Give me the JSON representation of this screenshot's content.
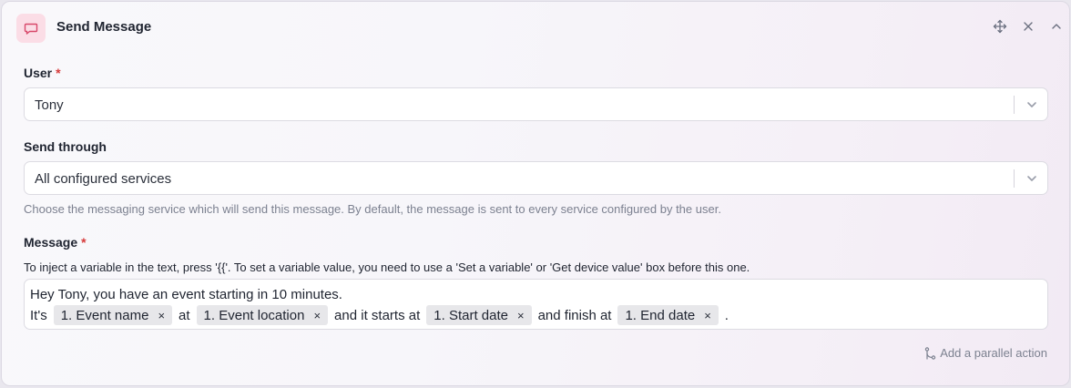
{
  "header": {
    "title": "Send Message",
    "icon": "message-icon",
    "actions": [
      "move-icon",
      "close-icon",
      "collapse-icon"
    ]
  },
  "user_field": {
    "label": "User",
    "required_mark": "*",
    "value": "Tony"
  },
  "send_through_field": {
    "label": "Send through",
    "value": "All configured services",
    "help": "Choose the messaging service which will send this message. By default, the message is sent to every service configured by the user."
  },
  "message_field": {
    "label": "Message",
    "required_mark": "*",
    "hint": "To inject a variable in the text, press '{{'. To set a variable value, you need to use a 'Set a variable' or 'Get device value' box before this one.",
    "line1": "Hey Tony, you have an event starting in 10 minutes.",
    "line2": {
      "prefix": "It's",
      "chip1": "1. Event name",
      "text1": "at",
      "chip2": "1. Event location",
      "text2": "and it starts at",
      "chip3": "1. Start date",
      "text3": "and finish at",
      "chip4": "1. End date",
      "suffix": ".",
      "remove_glyph": "×"
    }
  },
  "footer": {
    "parallel_action": "Add a parallel action"
  },
  "colors": {
    "accent_bg": "#fbdde6",
    "accent_icon": "#d8486a",
    "required": "#d63a3a"
  }
}
